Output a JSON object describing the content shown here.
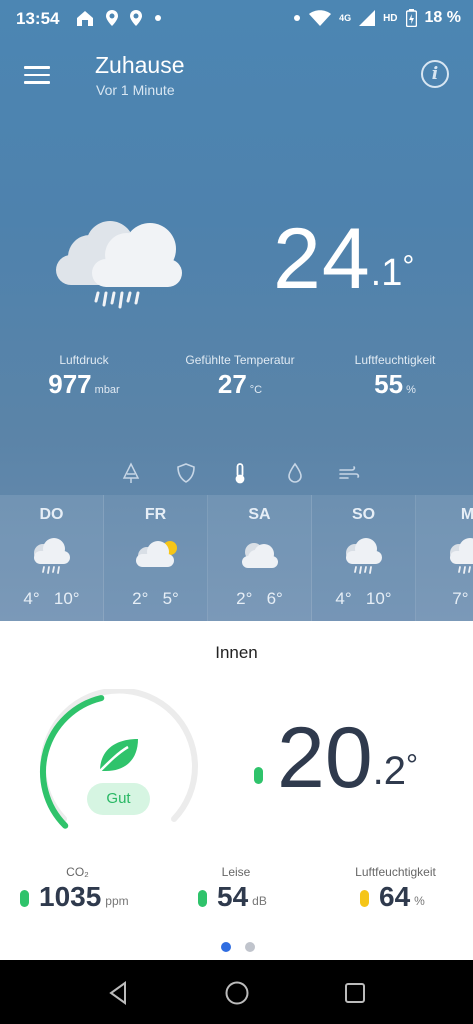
{
  "status_bar": {
    "time": "13:54",
    "network": "4G",
    "hd": "HD",
    "battery": "18 %"
  },
  "header": {
    "location": "Zuhause",
    "updated": "Vor 1 Minute",
    "info_icon": "i"
  },
  "current": {
    "temp_int": "24",
    "temp_dec": ".1",
    "temp_deg": "°",
    "icon": "cloud-rain-icon",
    "stats": [
      {
        "label": "Luftdruck",
        "value": "977",
        "unit": "mbar"
      },
      {
        "label": "Gefühlte Temperatur",
        "value": "27",
        "unit": "°C"
      },
      {
        "label": "Luftfeuchtigkeit",
        "value": "55",
        "unit": "%"
      }
    ]
  },
  "modes": [
    "tree-icon",
    "shield-icon",
    "thermometer-icon",
    "drop-icon",
    "wind-icon"
  ],
  "forecast": [
    {
      "day": "DO",
      "icon": "cloud-rain-icon",
      "min": "4°",
      "max": "10°"
    },
    {
      "day": "FR",
      "icon": "sun-cloud-icon",
      "min": "2°",
      "max": "5°"
    },
    {
      "day": "SA",
      "icon": "cloud-icon",
      "min": "2°",
      "max": "6°"
    },
    {
      "day": "SO",
      "icon": "cloud-rain-icon",
      "min": "4°",
      "max": "10°"
    },
    {
      "day": "M",
      "icon": "cloud-rain-icon",
      "min": "7°",
      "max": ""
    }
  ],
  "indoor": {
    "title": "Innen",
    "quality_label": "Gut",
    "quality_fraction": 0.45,
    "temp_int": "20",
    "temp_dec": ".2",
    "temp_deg": "°",
    "stats": [
      {
        "label": "CO₂",
        "value": "1035",
        "unit": "ppm",
        "color": "#2fc36b"
      },
      {
        "label": "Leise",
        "value": "54",
        "unit": "dB",
        "color": "#2fc36b"
      },
      {
        "label": "Luftfeuchtigkeit",
        "value": "64",
        "unit": "%",
        "color": "#f5c518"
      }
    ]
  },
  "colors": {
    "accent_green": "#2fc36b",
    "accent_yellow": "#f5c518",
    "dot_active": "#2f6de1",
    "dark_text": "#2f3a4d"
  }
}
